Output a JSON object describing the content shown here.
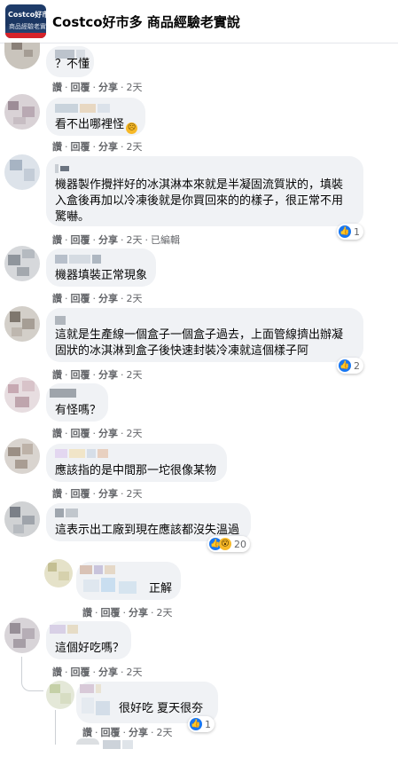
{
  "group": {
    "logo_line1": "Costco好市",
    "logo_line2": "商品經驗老實說",
    "title": "Costco好市多 商品經驗老實說"
  },
  "actions": {
    "like": "讚",
    "reply": "回覆",
    "share": "分享",
    "edited": "已編輯"
  },
  "comments": [
    {
      "text": "？不懂",
      "time": "2天"
    },
    {
      "text": "看不出哪裡怪",
      "time": "2天",
      "emoji": "weary-face-emoji"
    },
    {
      "text1": "機器製作攪拌好的冰淇淋本來就是半凝固流質狀的，填裝",
      "text2": "入盒後再加以冷凍後就是你買回來的的樣子，很正常不用",
      "text3": "驚嚇。",
      "time": "2天",
      "reactions": "1"
    },
    {
      "text": "機器填裝正常現象",
      "time": "2天"
    },
    {
      "text1": "這就是生產線一個盒子一個盒子過去，上面管線擠出辦凝",
      "text2": "固狀的冰淇淋到盒子後快速封裝冷凍就這個樣子阿",
      "time": "2天",
      "reactions": "2"
    },
    {
      "text": "有怪嗎？",
      "time": "2天"
    },
    {
      "text": "應該指的是中間那一坨很像某物",
      "time": "2天"
    },
    {
      "text": "這表示出工廠到現在應該都沒失溫過",
      "time": "2天",
      "reactions": "20"
    },
    {
      "text": "正解",
      "time": "2天"
    },
    {
      "text": "這個好吃嗎？",
      "time": "2天"
    },
    {
      "text": "很好吃 夏天很夯",
      "time": "2天",
      "reactions": "1"
    }
  ]
}
